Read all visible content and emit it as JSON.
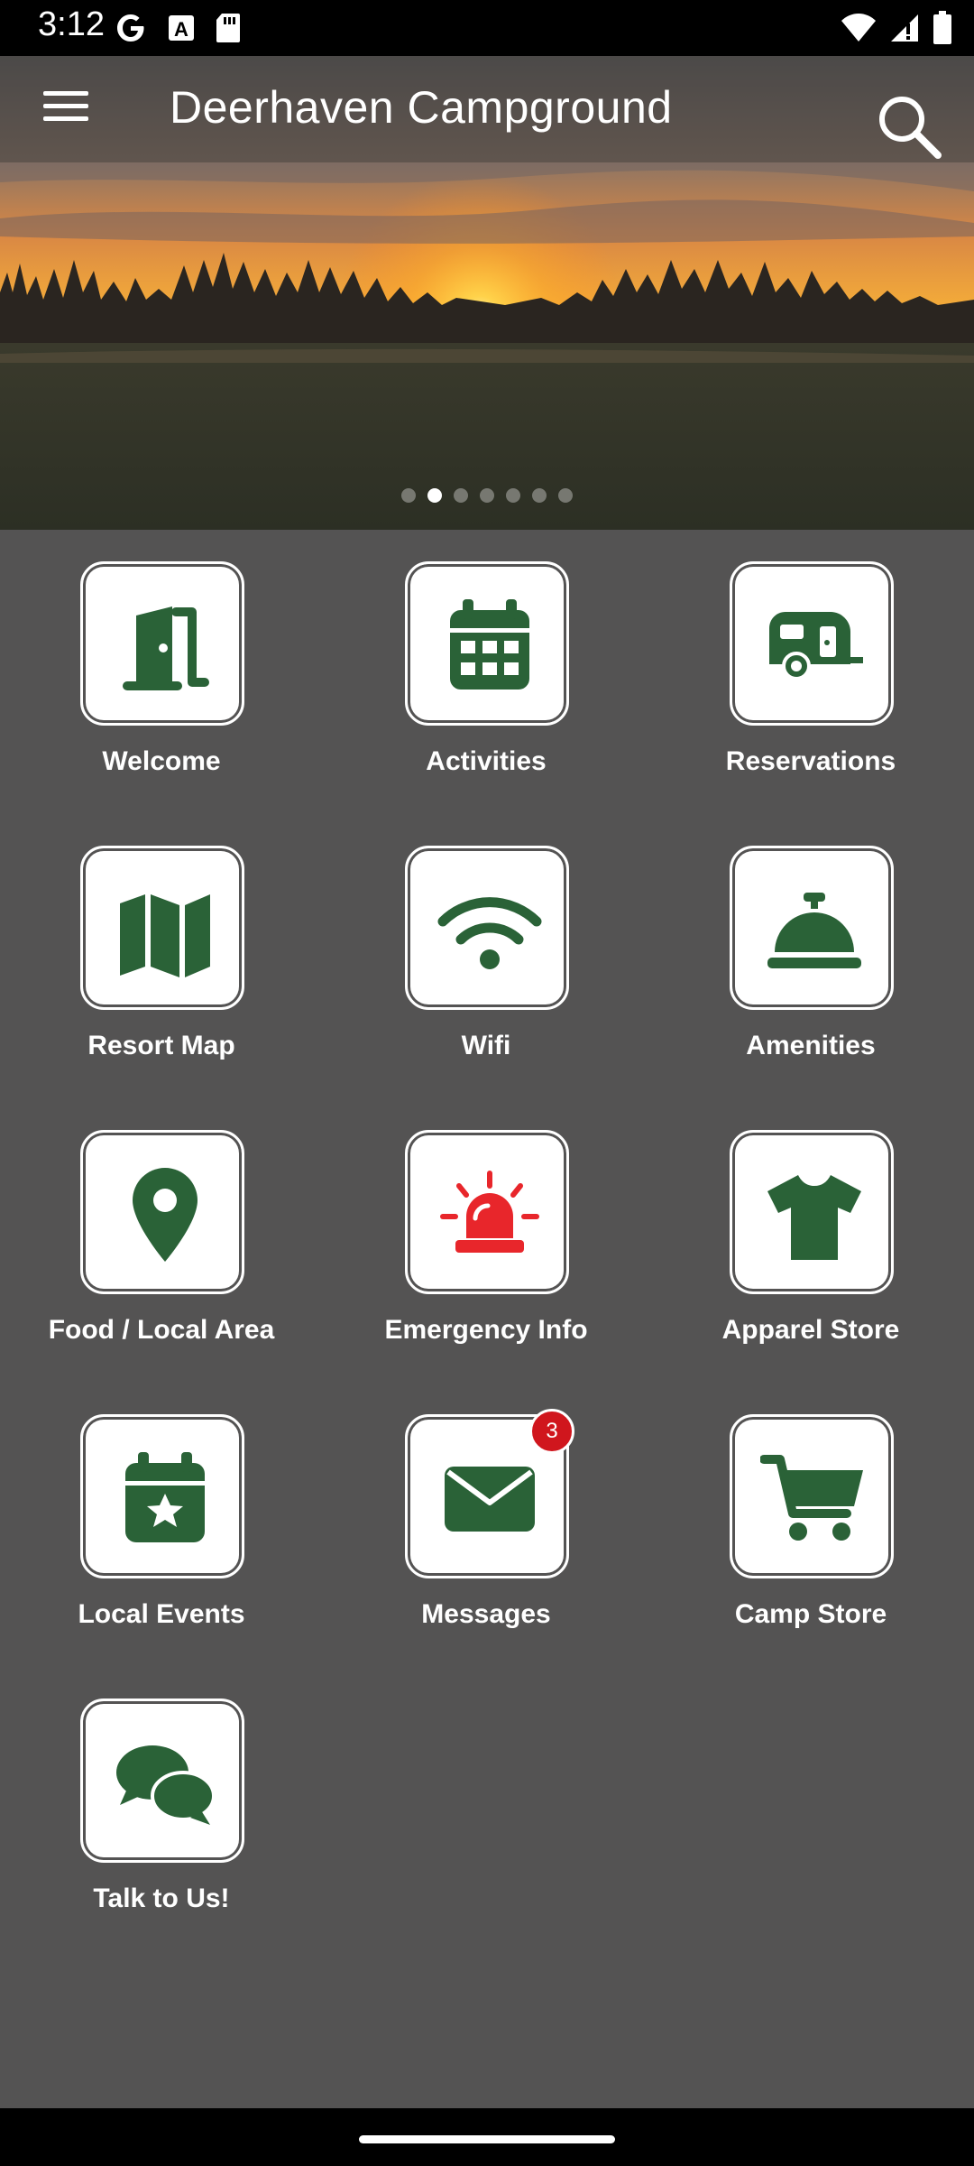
{
  "status_bar": {
    "time": "3:12",
    "left_icons": [
      "google-icon",
      "text-a-icon",
      "sd-card-icon"
    ],
    "right_icons": [
      "wifi-icon",
      "signal-icon",
      "battery-icon"
    ]
  },
  "app_bar": {
    "title": "Deerhaven Campground",
    "menu_icon": "hamburger-menu-icon",
    "search_icon": "search-icon"
  },
  "carousel": {
    "slide_count": 7,
    "active_index": 1
  },
  "colors": {
    "background": "#545353",
    "icon_green": "#2a6237",
    "icon_red": "#e8262b",
    "badge_red": "#d0161d"
  },
  "tiles": [
    {
      "label": "Welcome",
      "icon": "door-open-icon"
    },
    {
      "label": "Activities",
      "icon": "calendar-icon"
    },
    {
      "label": "Reservations",
      "icon": "camper-trailer-icon"
    },
    {
      "label": "Resort Map",
      "icon": "map-icon"
    },
    {
      "label": "Wifi",
      "icon": "wifi-icon"
    },
    {
      "label": "Amenities",
      "icon": "concierge-bell-icon"
    },
    {
      "label": "Food / Local Area",
      "icon": "map-pin-icon"
    },
    {
      "label": "Emergency Info",
      "icon": "siren-icon"
    },
    {
      "label": "Apparel Store",
      "icon": "t-shirt-icon"
    },
    {
      "label": "Local Events",
      "icon": "calendar-star-icon"
    },
    {
      "label": "Messages",
      "icon": "envelope-icon",
      "badge": "3"
    },
    {
      "label": "Camp Store",
      "icon": "shopping-cart-icon"
    },
    {
      "label": "Talk to Us!",
      "icon": "chat-bubbles-icon"
    }
  ]
}
